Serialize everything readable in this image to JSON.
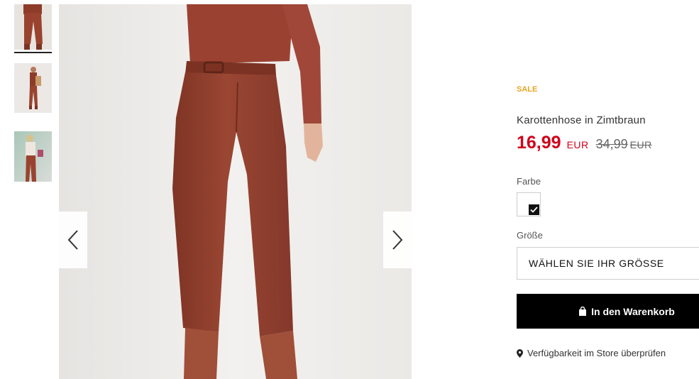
{
  "gallery": {
    "prev_icon": "chevron-left-icon",
    "next_icon": "chevron-right-icon",
    "thumbnails": [
      "thumbnail-front",
      "thumbnail-full-body",
      "thumbnail-side"
    ]
  },
  "product": {
    "sale_badge": "SALE",
    "title": "Karottenhose in Zimtbraun",
    "price_current": "16,99",
    "price_currency": "EUR",
    "price_old": "34,99",
    "price_old_currency": "EUR"
  },
  "options": {
    "color_label": "Farbe",
    "size_label": "Größe",
    "size_placeholder": "WÄHLEN SIE IHR GRÖSSE"
  },
  "actions": {
    "cart_label": "In den Warenkorb",
    "cart_icon": "shopping-bag-icon",
    "store_label": "Verfügbarkeit im Store überprüfen",
    "store_icon": "map-pin-icon"
  },
  "colors": {
    "sale": "#e7a51f",
    "price": "#d0021b",
    "product_color": "#8e3c2a"
  }
}
